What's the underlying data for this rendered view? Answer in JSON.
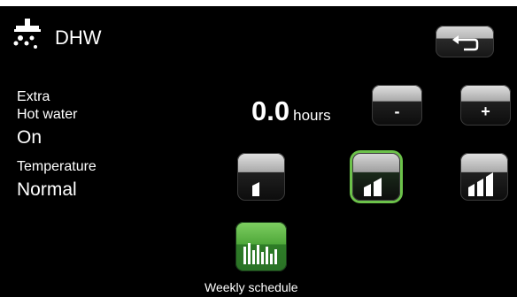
{
  "header": {
    "title": "DHW",
    "icon": "faucet-icon"
  },
  "extra_hot_water": {
    "label_line1": "Extra",
    "label_line2": "Hot water",
    "state": "On",
    "hours_value": "0.0",
    "hours_unit": "hours",
    "decrease_label": "-",
    "increase_label": "+"
  },
  "temperature": {
    "label": "Temperature",
    "value": "Normal",
    "levels": [
      "low",
      "normal",
      "high"
    ],
    "selected_level": "normal"
  },
  "weekly_schedule": {
    "label": "Weekly schedule"
  },
  "colors": {
    "background": "#000000",
    "text": "#ffffff",
    "accent_green": "#6cc24a",
    "schedule_green": "#4fa83a"
  }
}
